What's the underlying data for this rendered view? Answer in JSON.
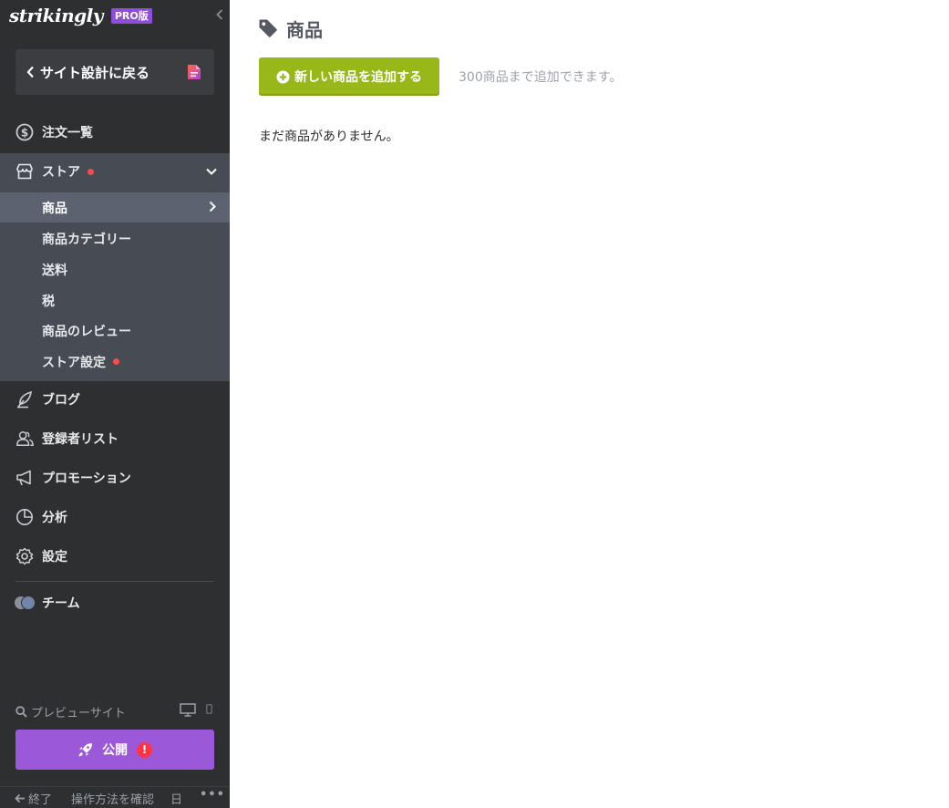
{
  "app": {
    "logo": "strikingly",
    "badge": "PRO版"
  },
  "sidebar": {
    "back_label": "サイト設計に戻る",
    "orders": "注文一覧",
    "store": {
      "label": "ストア",
      "items": [
        "商品",
        "商品カテゴリー",
        "送料",
        "税",
        "商品のレビュー",
        "ストア設定"
      ]
    },
    "blog": "ブログ",
    "subscribers": "登録者リスト",
    "promotion": "プロモーション",
    "analytics": "分析",
    "settings": "設定",
    "team": "チーム",
    "preview": "プレビューサイト",
    "publish": "公開",
    "publish_badge": "!",
    "footer": {
      "exit": "終了",
      "help": "操作方法を確認",
      "lang": "日",
      "more": "•••"
    }
  },
  "main": {
    "title": "商品",
    "add_button": "新しい商品を追加する",
    "limit_note": "300商品まで追加できます。",
    "empty_message": "まだ商品がありません。"
  },
  "colors": {
    "sidebar_bg": "#2e2f31",
    "store_bg": "#474b54",
    "active_bg": "#5c6270",
    "publish": "#9b59d9",
    "add_button": "#98b81a",
    "alert_dot": "#ff4a4a"
  }
}
